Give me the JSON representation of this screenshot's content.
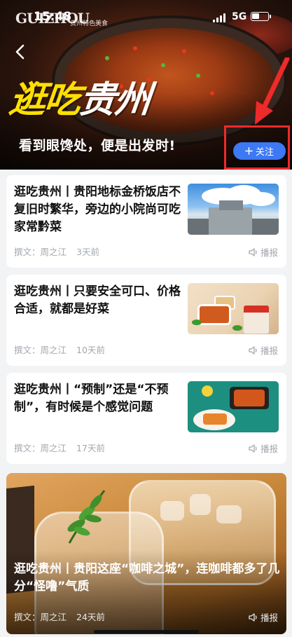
{
  "status_bar": {
    "time": "15:48",
    "network": "5G",
    "brand_logo": "GUIZHOU",
    "brand_sub": "贵州特色美食"
  },
  "hero": {
    "title_highlight": "逛吃",
    "title_rest": "贵州",
    "subtitle": "看到眼馋处，便是出发时!",
    "follow_label": "关注"
  },
  "articles": [
    {
      "title": "逛吃贵州丨贵阳地标金桥饭店不复旧时繁华，旁边的小院尚可吃家常黔菜",
      "author": "撰文：周之江",
      "time_ago": "3天前",
      "speak_label": "播报",
      "thumb": "building-photo"
    },
    {
      "title": "逛吃贵州丨只要安全可口、价格合适，就都是好菜",
      "author": "撰文：周之江",
      "time_ago": "10天前",
      "speak_label": "播报",
      "thumb": "prepared-meal-photo"
    },
    {
      "title": "逛吃贵州丨“预制”还是“不预制”，有时候是个感觉问题",
      "author": "撰文：周之江",
      "time_ago": "17天前",
      "speak_label": "播报",
      "thumb": "food-plates-photo"
    }
  ],
  "featured": {
    "title": "逛吃贵州丨贵阳这座“咖啡之城”，连咖啡都多了几分“怪噜”气质",
    "author": "撰文：周之江",
    "time_ago": "24天前",
    "speak_label": "播报",
    "image": "iced-coffee-photo"
  },
  "colors": {
    "accent_blue": "#3d78f5",
    "highlight_yellow": "#ffe000",
    "annotation_red": "#ee2a2a"
  }
}
